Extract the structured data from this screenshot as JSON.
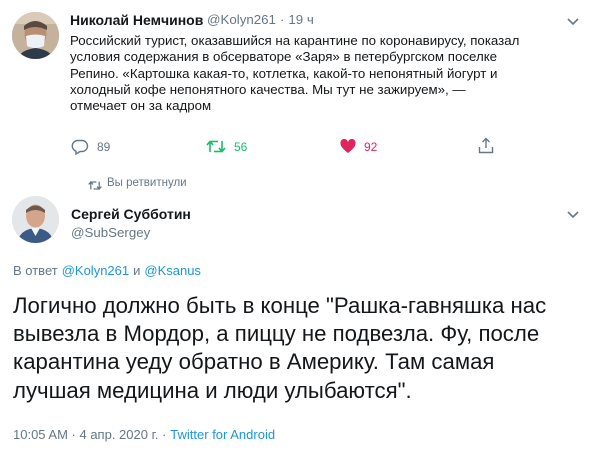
{
  "tweet1": {
    "author_name": "Николай Немчинов",
    "handle": "@Kolyn261",
    "separator": "·",
    "time": "19 ч",
    "text_lines": [
      "Российский турист, оказавшийся на карантине по коронавирусу, показал",
      "условия содержания в обсерваторе «Заря» в петербургском поселке",
      "Репино. «Картошка какая-то, котлетка, какой-то непонятный йогурт и",
      "холодный кофе непонятного качества. Мы тут не зажируем», —",
      "отмечает он за кадром"
    ],
    "reply_count": "89",
    "retweet_count": "56",
    "like_count": "92"
  },
  "retweeted_label": "Вы ретвитнули",
  "tweet2": {
    "author_name": "Сергей Субботин",
    "handle": "@SubSergey",
    "reply_prefix": "В ответ",
    "reply_user1": "@Kolyn261",
    "reply_and": "и",
    "reply_user2": "@Ksanus",
    "text_lines": [
      "Логично должно быть в конце \"Рашка-гавняшка нас",
      "вывезла в Мордор, а пиццу не подвезла. Фу, после",
      "карантина уеду обратно в Америку. Там самая",
      "лучшая медицина и люди улыбаются\"."
    ],
    "timestamp": "10:05 AM · 4 апр. 2020 г. ·",
    "source": "Twitter for Android"
  },
  "colors": {
    "link": "#1b95e0",
    "muted": "#657786",
    "retweet_green": "#17bf63",
    "like_red": "#e0245e"
  }
}
